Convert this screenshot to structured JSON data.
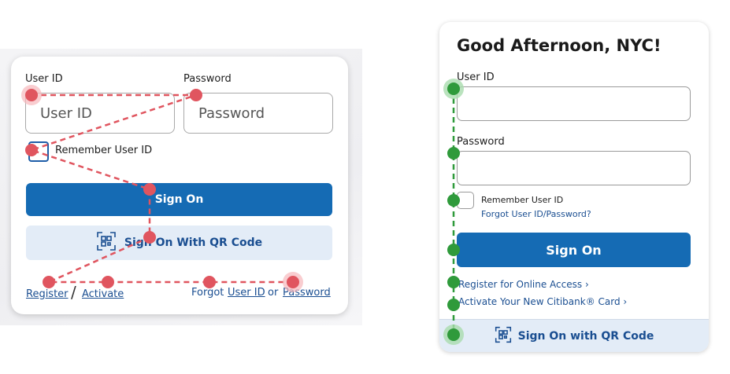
{
  "left_card": {
    "user_id_label": "User ID",
    "password_label": "Password",
    "user_id_placeholder": "User ID",
    "password_placeholder": "Password",
    "remember_label": "Remember User ID",
    "sign_on_label": "Sign On",
    "qr_label": "Sign On With QR Code",
    "register_link": "Register",
    "slash": "/",
    "activate_link": "Activate",
    "forgot_text": "Forgot",
    "forgot_user_id_link": "User ID",
    "or_text": "or",
    "forgot_password_link": "Password"
  },
  "right_card": {
    "greeting": "Good Afternoon, NYC!",
    "user_id_label": "User ID",
    "password_label": "Password",
    "remember_label": "Remember User ID",
    "forgot_link": "Forgot User ID/Password?",
    "sign_on_label": "Sign On",
    "register_link": "Register for Online Access ›",
    "activate_link": "Activate Your New Citibank® Card ›",
    "qr_label": "Sign On with QR Code"
  },
  "colors": {
    "primary_button": "#156bb4",
    "link": "#1a4e91",
    "qr_bar": "#e3ecf7",
    "red_path": "#e0555f",
    "green_path": "#2f9a3b"
  }
}
